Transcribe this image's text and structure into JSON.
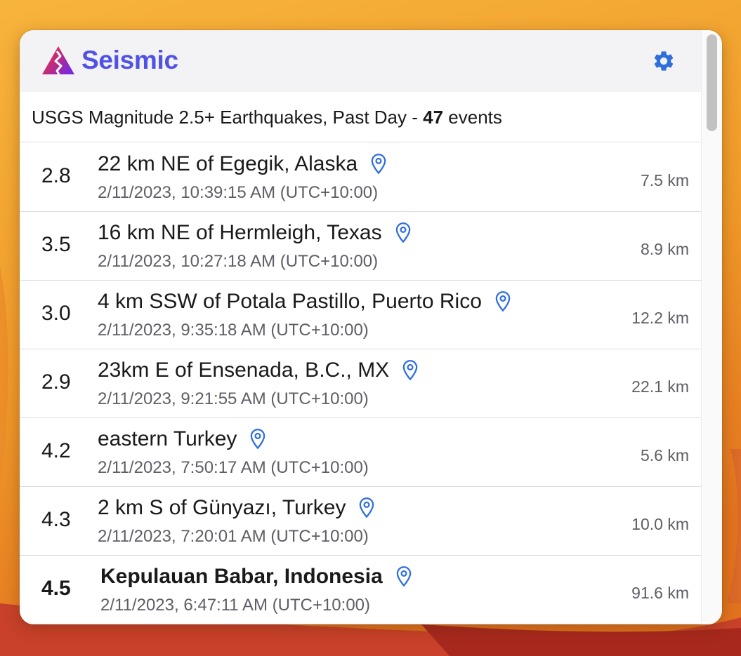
{
  "app": {
    "title": "Seismic",
    "brand_color": "#4f52e3",
    "logo_icon": "mountain-seismic-logo",
    "settings_icon": "gear-icon"
  },
  "feed": {
    "label": "USGS Magnitude 2.5+ Earthquakes, Past Day -",
    "count": "47",
    "count_suffix": "events"
  },
  "events": [
    {
      "mag": "2.8",
      "place": "22 km NE of Egegik, Alaska",
      "time": "2/11/2023, 10:39:15 AM (UTC+10:00)",
      "depth": "7.5 km",
      "strong": false
    },
    {
      "mag": "3.5",
      "place": "16 km NE of Hermleigh, Texas",
      "time": "2/11/2023, 10:27:18 AM (UTC+10:00)",
      "depth": "8.9 km",
      "strong": false
    },
    {
      "mag": "3.0",
      "place": "4 km SSW of Potala Pastillo, Puerto Rico",
      "time": "2/11/2023, 9:35:18 AM (UTC+10:00)",
      "depth": "12.2 km",
      "strong": false
    },
    {
      "mag": "2.9",
      "place": "23km E of Ensenada, B.C., MX",
      "time": "2/11/2023, 9:21:55 AM (UTC+10:00)",
      "depth": "22.1 km",
      "strong": false
    },
    {
      "mag": "4.2",
      "place": "eastern Turkey",
      "time": "2/11/2023, 7:50:17 AM (UTC+10:00)",
      "depth": "5.6 km",
      "strong": false
    },
    {
      "mag": "4.3",
      "place": "2 km S of Günyazı, Turkey",
      "time": "2/11/2023, 7:20:01 AM (UTC+10:00)",
      "depth": "10.0 km",
      "strong": false
    },
    {
      "mag": "4.5",
      "place": "Kepulauan Babar, Indonesia",
      "time": "2/11/2023, 6:47:11 AM (UTC+10:00)",
      "depth": "91.6 km",
      "strong": true
    }
  ],
  "icons": {
    "location": "map-pin-icon"
  },
  "colors": {
    "pin": "#2f6fdc",
    "gear": "#2f6fdc"
  }
}
